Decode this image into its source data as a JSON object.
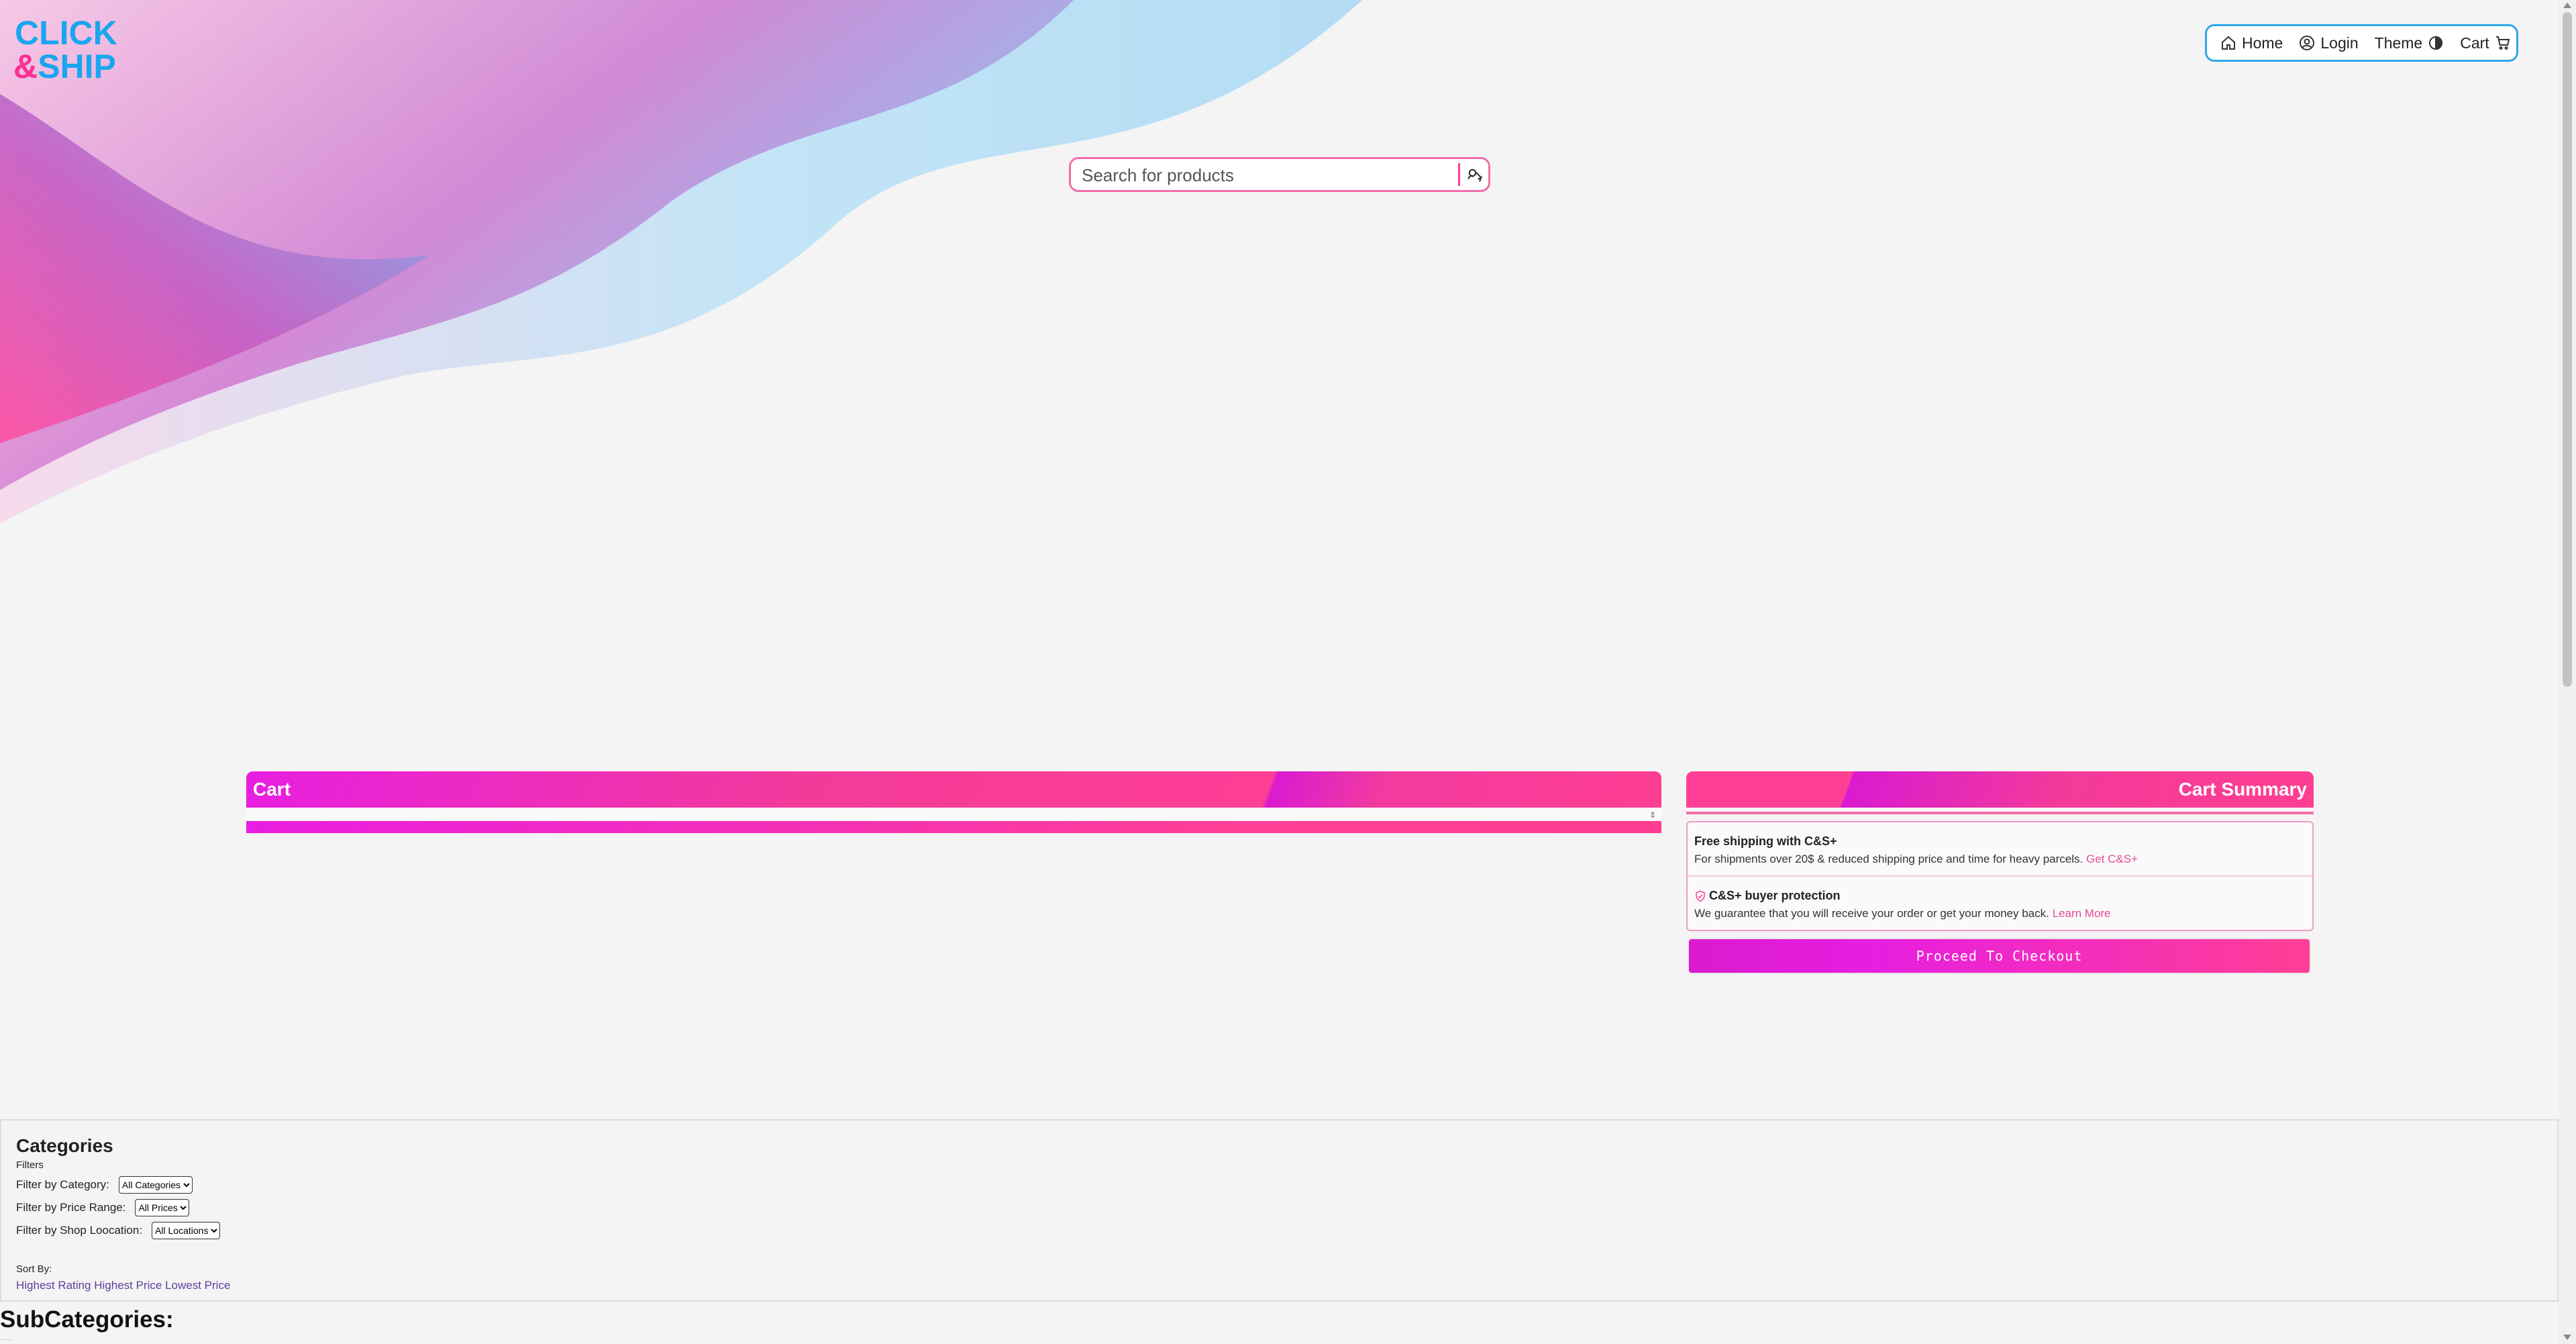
{
  "brand": {
    "logo_line1": "CLICK",
    "logo_line2": "&SHIP"
  },
  "nav": {
    "home": "Home",
    "login": "Login",
    "theme": "Theme",
    "cart": "Cart"
  },
  "search": {
    "placeholder": "Search for products"
  },
  "cart": {
    "title": "Cart"
  },
  "summary": {
    "title": "Cart Summary",
    "perks": [
      {
        "title": "Free shipping with C&S+",
        "text": "For shipments over 20$ & reduced shipping price and time for heavy parcels.",
        "link": "Get C&S+"
      },
      {
        "title": "C&S+ buyer protection",
        "text": "We guarantee that you will receive your order or get your money back.",
        "link": "Learn More"
      }
    ],
    "checkout": "Proceed To Checkout"
  },
  "filters": {
    "title": "Categories",
    "subtitle": "Filters",
    "category_label": "Filter by Category:",
    "category_value": "All Categories",
    "price_label": "Filter by Price Range:",
    "price_value": "All Prices",
    "location_label": "Filter by Shop Loocation:",
    "location_value": "All Locations",
    "sort_label": "Sort By:",
    "sort_options": [
      "Highest Rating",
      "Highest Price",
      "Lowest Price"
    ]
  },
  "subcategories": {
    "title": "SubCategories:"
  },
  "colors": {
    "accent_pink": "#ff3f95",
    "accent_magenta": "#e81ee0",
    "accent_blue": "#2ea7e8"
  }
}
